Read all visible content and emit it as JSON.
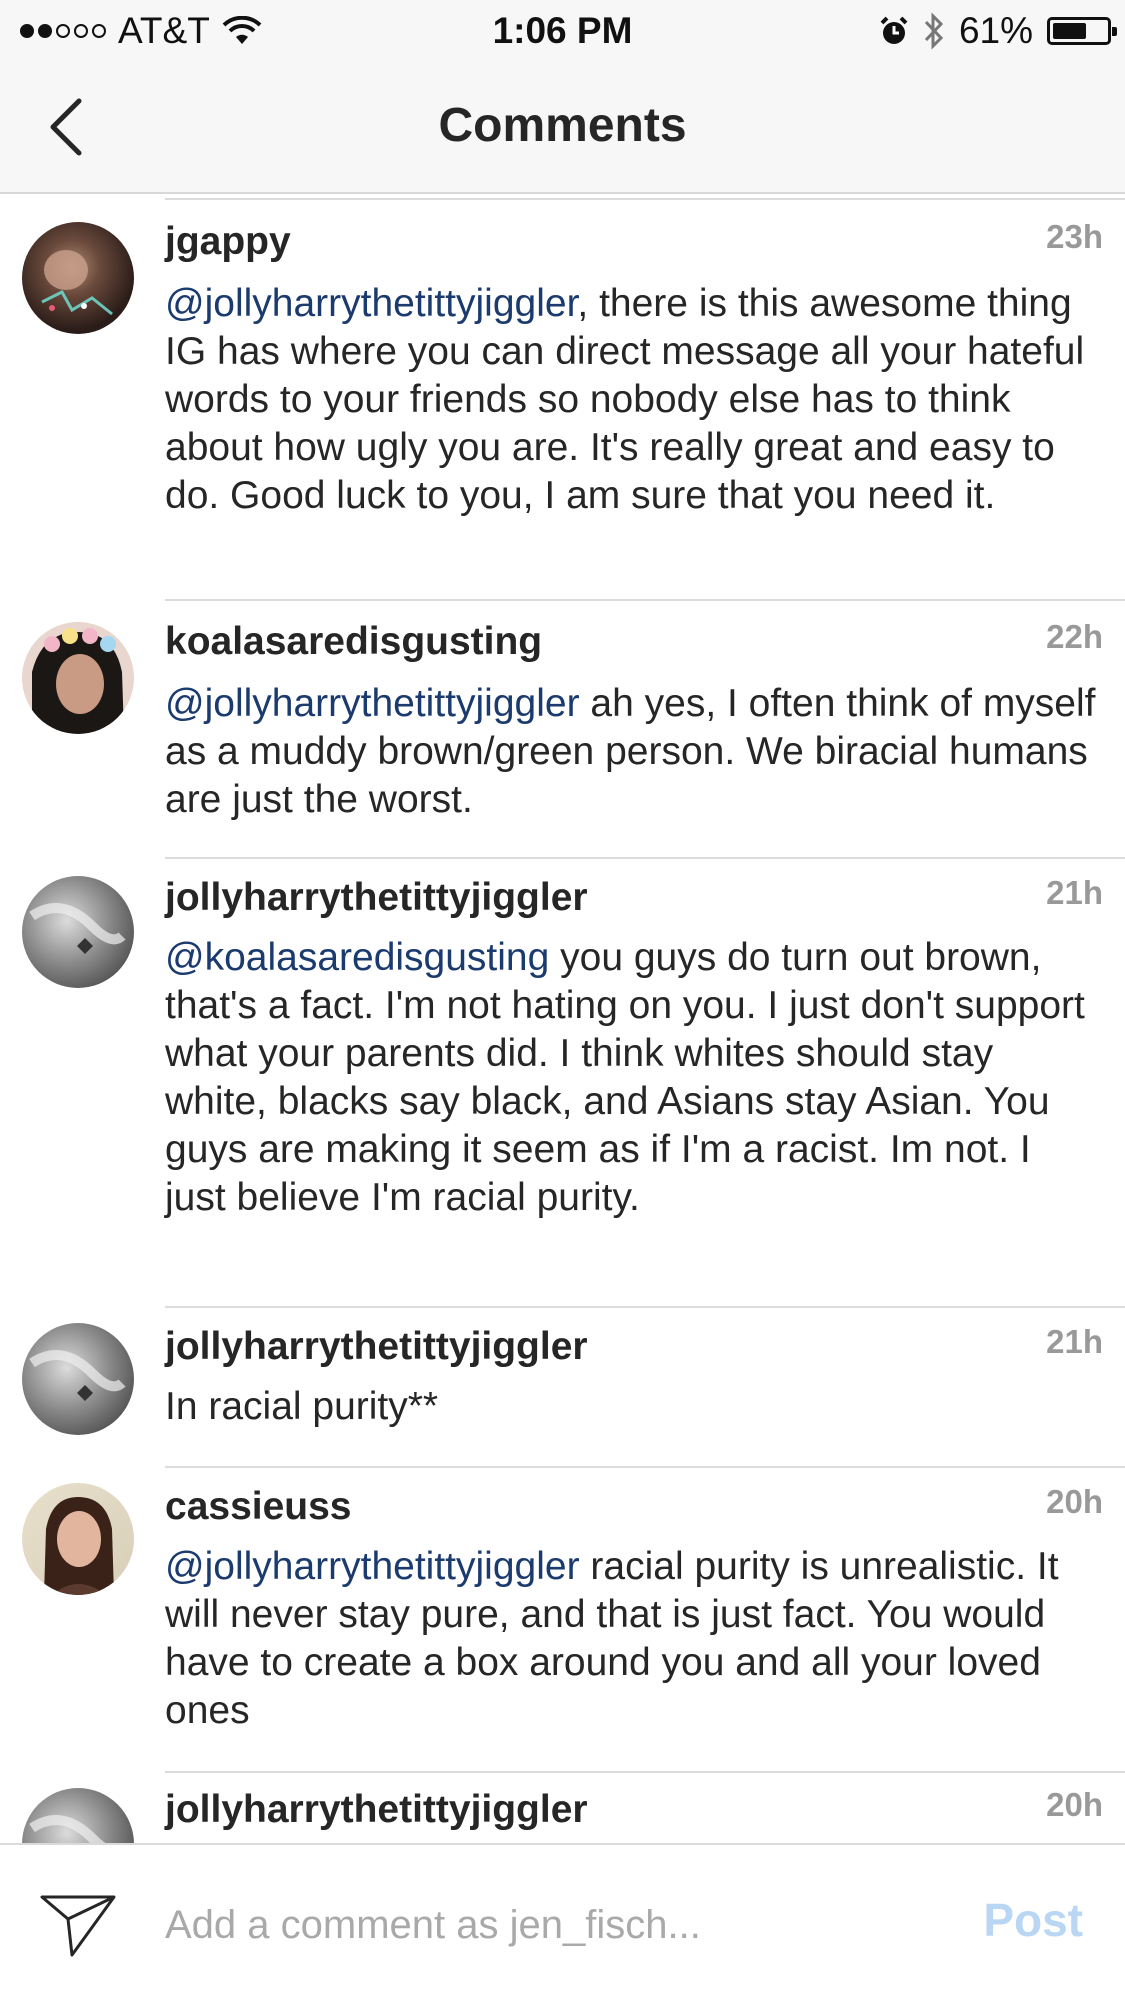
{
  "status_bar": {
    "carrier": "AT&T",
    "time": "1:06 PM",
    "battery": "61%",
    "battery_level": 0.61,
    "signal_bars_filled": 2,
    "signal_bars_total": 5
  },
  "nav": {
    "title": "Comments",
    "back_icon": "chevron-left-icon"
  },
  "comments": [
    {
      "username": "jgappy",
      "time": "23h",
      "mention": "@jollyharrythetittyjiggler",
      "text": ", there is this awesome thing IG has where you can direct message all your hateful words to your friends so nobody else has to think about how ugly you are. It's really great and easy to do. Good luck to you, I am sure that you need it."
    },
    {
      "username": "koalasaredisgusting",
      "time": "22h",
      "mention": "@jollyharrythetittyjiggler",
      "text": " ah yes, I often think of myself as a muddy brown/green person. We biracial humans are just the worst."
    },
    {
      "username": "jollyharrythetittyjiggler",
      "time": "21h",
      "mention": "@koalasaredisgusting",
      "text": " you guys do turn out brown, that's a fact. I'm not hating on you. I just don't support what your parents did. I think whites should stay white, blacks say black, and Asians stay Asian. You guys are making it seem as if I'm a racist. Im not. I just believe I'm racial purity."
    },
    {
      "username": "jollyharrythetittyjiggler",
      "time": "21h",
      "mention": "",
      "text": "In racial purity**"
    },
    {
      "username": "cassieuss",
      "time": "20h",
      "mention": "@jollyharrythetittyjiggler",
      "text": " racial purity is unrealistic. It will never stay pure, and that is just fact. You would have to create a box around you and all your loved ones"
    },
    {
      "username": "jollyharrythetittyjiggler",
      "time": "20h",
      "mention": "",
      "text": ""
    }
  ],
  "input_bar": {
    "placeholder": "Add a comment as jen_fisch...",
    "value": "",
    "post_label": "Post",
    "send_icon": "paper-plane-icon"
  },
  "colors": {
    "mention": "#1b3b6f",
    "timestamp": "#999999",
    "post_disabled": "#b9d6f4",
    "bar_background": "#f7f7f7"
  }
}
